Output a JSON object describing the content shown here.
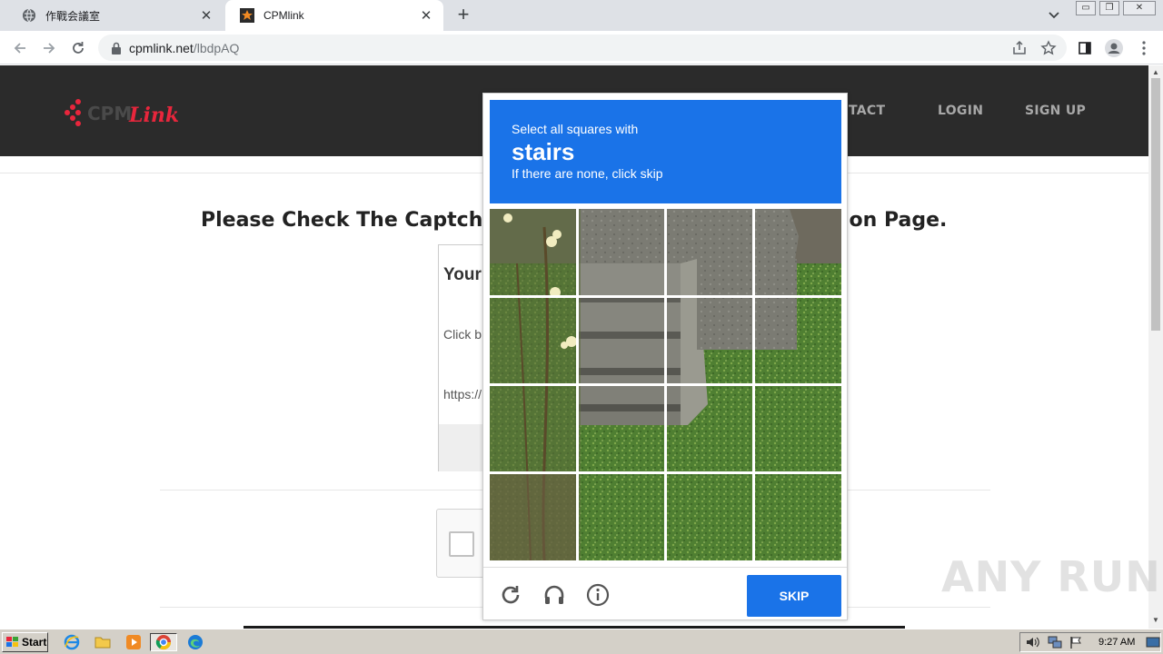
{
  "browser": {
    "tabs": [
      {
        "title": "作戰会議室",
        "active": false
      },
      {
        "title": "CPMlink",
        "active": true
      }
    ],
    "new_tab": "+",
    "address": {
      "host": "cpmlink.net",
      "path": "/lbdpAQ"
    }
  },
  "site": {
    "nav": [
      "CONTACT",
      "LOGIN",
      "SIGN UP"
    ],
    "nav_visible": [
      "NTACT",
      "LOGIN",
      "SIGN UP"
    ],
    "headline_left": "Please Check The Captcha",
    "headline_right": "ion Page.",
    "card": {
      "title": "Your",
      "text": "Click b",
      "link": "https://"
    }
  },
  "captcha": {
    "instruction": "Select all squares with",
    "target": "stairs",
    "hint": "If there are none, click skip",
    "skip_label": "SKIP",
    "icons": [
      "reload-icon",
      "audio-icon",
      "info-icon"
    ]
  },
  "watermark": "ANY RUN",
  "taskbar": {
    "start_label": "Start",
    "clock": "9:27 AM",
    "apps": [
      "ie-icon",
      "folder-icon",
      "media-player-icon",
      "chrome-icon",
      "edge-icon"
    ]
  },
  "colors": {
    "captcha_blue": "#1a73e8",
    "header_dark": "#2b2b2b",
    "logo_red": "#e8263c"
  }
}
